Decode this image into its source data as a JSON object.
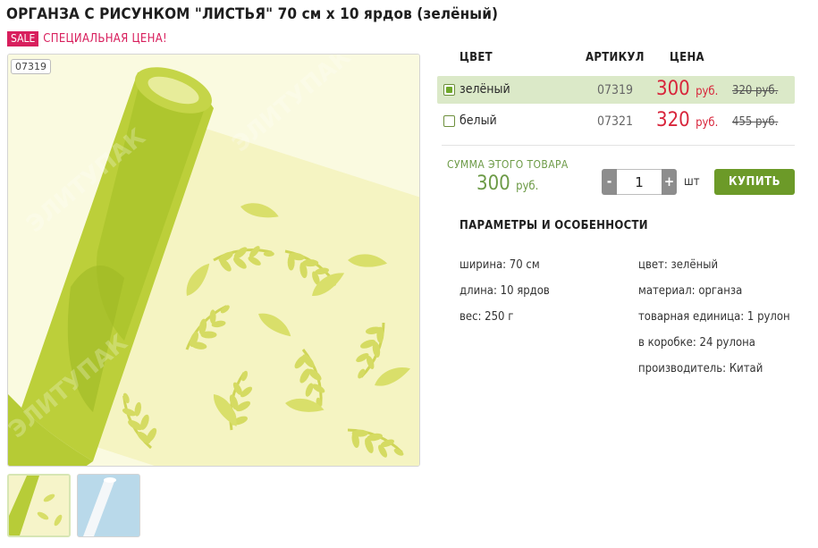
{
  "product": {
    "title": "ОРГАНЗА С РИСУНКОМ \"ЛИСТЬЯ\" 70 см х 10 ярдов (зелёный)",
    "sale_badge": "SALE",
    "sale_text": "СПЕЦИАЛЬНАЯ ЦЕНА!",
    "image_sku": "07319",
    "watermark": "ЭЛИТУПАК"
  },
  "variants_table": {
    "headers": {
      "color": "ЦВЕТ",
      "article": "АРТИКУЛ",
      "price": "ЦЕНА"
    },
    "rows": [
      {
        "name": "зелёный",
        "article": "07319",
        "price": "300",
        "currency": "руб.",
        "old_price": "320 руб.",
        "selected": true
      },
      {
        "name": "белый",
        "article": "07321",
        "price": "320",
        "currency": "руб.",
        "old_price": "455 руб.",
        "selected": false
      }
    ]
  },
  "order": {
    "sum_label": "СУММА ЭТОГО ТОВАРА",
    "sum_value": "300",
    "sum_currency": "руб.",
    "minus_label": "-",
    "plus_label": "+",
    "quantity": "1",
    "unit": "шт",
    "buy_label": "КУПИТЬ"
  },
  "params": {
    "title": "ПАРАМЕТРЫ И ОСОБЕННОСТИ",
    "left": [
      "ширина: 70 см",
      "длина: 10 ярдов",
      "вес: 250 г"
    ],
    "right": [
      "цвет: зелёный",
      "материал: органза",
      "товарная единица: 1 рулон",
      "в коробке: 24 рулона",
      "производитель: Китай"
    ]
  },
  "colors": {
    "sale": "#d81f5d",
    "price": "#d8253b",
    "accent_green": "#6c9a28",
    "selected_row": "#dbe9c8",
    "fabric": "#fbfbe4",
    "leaf": "#d9df6a"
  }
}
